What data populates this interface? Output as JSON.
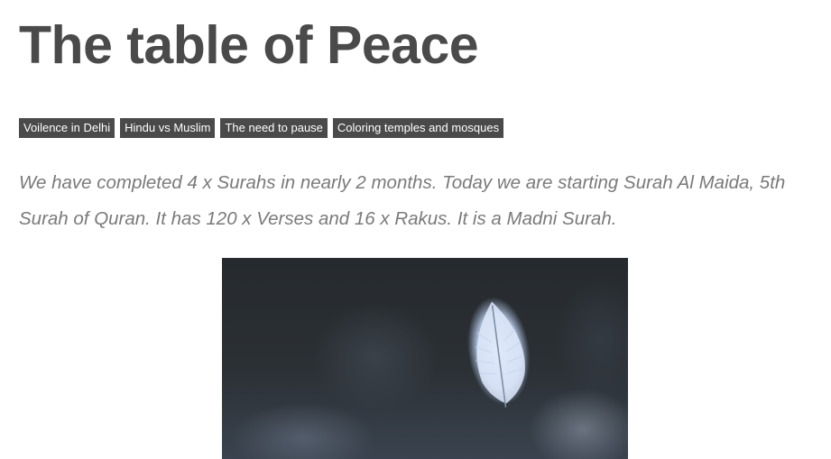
{
  "article": {
    "title": "The table of Peace",
    "tags": [
      "Voilence in Delhi",
      "Hindu vs Muslim",
      "The need to pause",
      "Coloring temples and mosques"
    ],
    "intro": "We have completed 4 x Surahs in nearly 2 months. Today we are starting Surah Al Maida, 5th Surah of Quran. It has 120 x Verses and 16 x Rakus. It is a Madni Surah."
  },
  "colors": {
    "title": "#4a4a4a",
    "tag_bg": "#4a4a4a",
    "intro_text": "#7a7a7a"
  }
}
